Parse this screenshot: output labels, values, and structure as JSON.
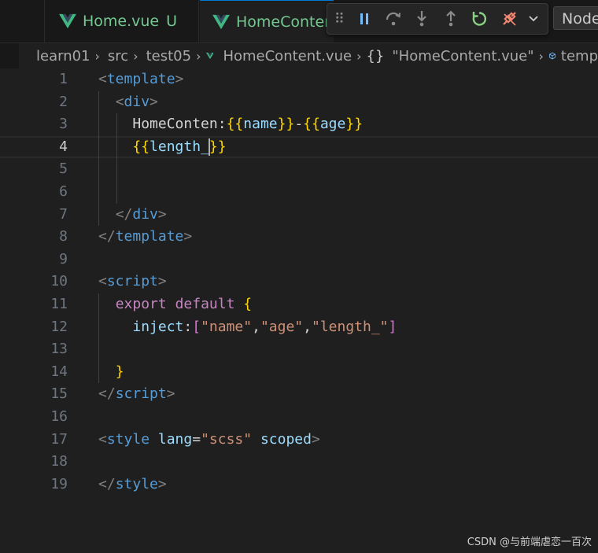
{
  "tabs": [
    {
      "label": "Home.vue",
      "status": "U"
    },
    {
      "label": "HomeConten"
    }
  ],
  "debug_toolbar": {
    "launch_target": "Node"
  },
  "breadcrumb": {
    "items": [
      "learn01",
      "src",
      "test05",
      "HomeContent.vue",
      "\"HomeContent.vue\"",
      "temp"
    ]
  },
  "editor": {
    "current_line": 4,
    "line_numbers": [
      "1",
      "2",
      "3",
      "4",
      "5",
      "6",
      "7",
      "8",
      "9",
      "10",
      "11",
      "12",
      "13",
      "14",
      "15",
      "16",
      "17",
      "18",
      "19"
    ],
    "lines": [
      [
        [
          "punc",
          "<"
        ],
        [
          "tag",
          "template"
        ],
        [
          "punc",
          ">"
        ]
      ],
      [
        [
          "ws",
          "  "
        ],
        [
          "punc",
          "<"
        ],
        [
          "tag",
          "div"
        ],
        [
          "punc",
          ">"
        ]
      ],
      [
        [
          "ws",
          "    "
        ],
        [
          "text",
          "HomeConten:"
        ],
        [
          "brace",
          "{{"
        ],
        [
          "var",
          "name"
        ],
        [
          "brace",
          "}}"
        ],
        [
          "text",
          "-"
        ],
        [
          "brace",
          "{{"
        ],
        [
          "var",
          "age"
        ],
        [
          "brace",
          "}}"
        ]
      ],
      [
        [
          "ws",
          "    "
        ],
        [
          "brace",
          "{{"
        ],
        [
          "var",
          "length_"
        ],
        [
          "cursor",
          ""
        ],
        [
          "brace",
          "}}"
        ]
      ],
      [],
      [],
      [
        [
          "ws",
          "  "
        ],
        [
          "punc",
          "</"
        ],
        [
          "tag",
          "div"
        ],
        [
          "punc",
          ">"
        ]
      ],
      [
        [
          "punc",
          "</"
        ],
        [
          "tag",
          "template"
        ],
        [
          "punc",
          ">"
        ]
      ],
      [],
      [
        [
          "punc",
          "<"
        ],
        [
          "tag",
          "script"
        ],
        [
          "punc",
          ">"
        ]
      ],
      [
        [
          "ws",
          "  "
        ],
        [
          "kw",
          "export"
        ],
        [
          "ws",
          " "
        ],
        [
          "kw",
          "default"
        ],
        [
          "ws",
          " "
        ],
        [
          "brace",
          "{"
        ]
      ],
      [
        [
          "ws",
          "    "
        ],
        [
          "var",
          "inject"
        ],
        [
          "text",
          ":"
        ],
        [
          "bracket",
          "["
        ],
        [
          "str",
          "\"name\""
        ],
        [
          "text",
          ","
        ],
        [
          "str",
          "\"age\""
        ],
        [
          "text",
          ","
        ],
        [
          "str",
          "\"length_\""
        ],
        [
          "bracket",
          "]"
        ]
      ],
      [],
      [
        [
          "ws",
          "  "
        ],
        [
          "brace",
          "}"
        ]
      ],
      [
        [
          "punc",
          "</"
        ],
        [
          "tag",
          "script"
        ],
        [
          "punc",
          ">"
        ]
      ],
      [],
      [
        [
          "punc",
          "<"
        ],
        [
          "tag",
          "style"
        ],
        [
          "ws",
          " "
        ],
        [
          "attr",
          "lang"
        ],
        [
          "eq",
          "="
        ],
        [
          "str",
          "\"scss\""
        ],
        [
          "ws",
          " "
        ],
        [
          "attr",
          "scoped"
        ],
        [
          "punc",
          ">"
        ]
      ],
      [],
      [
        [
          "punc",
          "</"
        ],
        [
          "tag",
          "style"
        ],
        [
          "punc",
          ">"
        ]
      ]
    ]
  },
  "watermark": "CSDN @与前端虐恋一百次",
  "colors": {
    "background": "#1f1f1f",
    "tag": "#569cd6",
    "keyword": "#c586c0",
    "string": "#ce9178",
    "variable": "#9cdcfe",
    "brace": "#ffd700",
    "vue_green": "#41b883",
    "modified": "#73c991"
  },
  "icons": [
    "vue-logo-icon",
    "drag-grip-icon",
    "pause-icon",
    "step-over-icon",
    "step-into-icon",
    "step-out-icon",
    "restart-icon",
    "disconnect-icon",
    "chevron-down-icon",
    "chevron-right-icon",
    "braces-icon",
    "symbol-cube-icon"
  ]
}
